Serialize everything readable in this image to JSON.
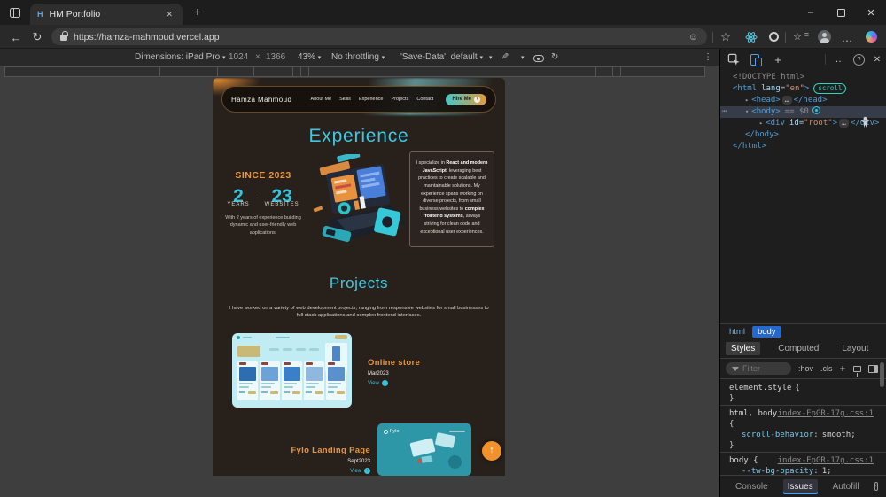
{
  "theme": {
    "cyan": "#3ec9e2",
    "orange": "#e8973b",
    "page_bg": "#28201b",
    "devtools_accent": "#4f9ee8"
  },
  "browser": {
    "tab_title": "HM Portfolio",
    "favicon_text": "H",
    "url": "https://hamza-mahmoud.vercel.app",
    "icons": {
      "back": "←",
      "refresh": "↻",
      "new_tab": "+",
      "close": "✕",
      "minimize": "–",
      "more": "…",
      "star": "☆",
      "smiley": "☺",
      "lines": "≡"
    }
  },
  "device_toolbar": {
    "dimensions": "Dimensions: iPad Pro",
    "width": "1024",
    "multiply": "×",
    "height": "1366",
    "zoom": "43%",
    "throttling": "No throttling",
    "save_data": "'Save-Data': default",
    "icons": {
      "caret": "▾",
      "eyedropper": "✎",
      "rotate": "↻",
      "kebab": "⋮"
    }
  },
  "page": {
    "logo": "Hamza Mahmoud",
    "nav": [
      "About Me",
      "Skills",
      "Experience",
      "Projects",
      "Contact"
    ],
    "hire_button": "Hire Me",
    "hire_arrow": "›",
    "scroll_arrow": "↑",
    "experience": {
      "heading": "Experience",
      "since": "SINCE 2023",
      "years_value": "2",
      "years_label": "YEARS",
      "separator": "·",
      "websites_value": "23",
      "websites_label": "WEBSITES",
      "summary": "With 2 years of experience building dynamic and user-friendly web applications.",
      "card": {
        "p1": "I specialize in ",
        "b1": "React and modern JavaScript",
        "p2": ", leveraging best practices to create scalable and maintainable solutions. My experience spans working on diverse projects, from small business websites to ",
        "b2": "complex frontend systems",
        "p3": ", always striving for clean code and exceptional user experiences."
      }
    },
    "projects": {
      "heading": "Projects",
      "intro": "I have worked on a variety of web development projects, ranging from responsive websites for small businesses to full stack applications and complex frontend interfaces.",
      "view_arrow": "›",
      "fylo_logo": "Fylo",
      "items": [
        {
          "name": "Online store",
          "date": "Mar2023",
          "view": "View"
        },
        {
          "name": "Fylo Landing Page",
          "date": "Sept2023",
          "view": "View"
        }
      ]
    }
  },
  "devtools": {
    "icons": {
      "plus": "+",
      "dots": "…",
      "help": "?",
      "close": "✕",
      "collapsed": "▸",
      "expanded": "▾",
      "gutter": "⋯",
      "chevron": "▾"
    },
    "tree": {
      "doctype": "<!DOCTYPE html>",
      "html_open": "<html",
      "html_attr": "lang",
      "eq": "=",
      "html_attr_value": "\"en\"",
      "gt": ">",
      "scroll_badge": "scroll",
      "head_open": "<head>",
      "ellipsis": "…",
      "head_close": "</head>",
      "body_open": "<body>",
      "selected_marker": "== $0",
      "div_open": "<div",
      "div_attr": "id",
      "div_attr_value": "\"root\"",
      "div_close": "</div>",
      "body_close": "</body>",
      "html_close": "</html>"
    },
    "crumbs": [
      "html",
      "body"
    ],
    "panel_tabs": [
      "Styles",
      "Computed",
      "Layout"
    ],
    "styles_toolbar": {
      "filter": "Filter",
      "hov": ":hov",
      "cls": ".cls"
    },
    "styles": {
      "element_style": "element.style",
      "brace_open": "{",
      "brace_close": "}",
      "colon": ":",
      "semicolon": ";",
      "rule1_selector": "html, body",
      "rule1_source": "index-EpGR-17g.css:1",
      "rule1_property": "scroll-behavior",
      "rule1_value": "smooth",
      "rule2_selector": "body {",
      "rule2_source": "index-EpGR-17g.css:1",
      "rule2_property": "--tw-bg-opacity",
      "rule2_value": "1"
    },
    "drawer_tabs": [
      "Console",
      "Issues",
      "Autofill"
    ]
  }
}
